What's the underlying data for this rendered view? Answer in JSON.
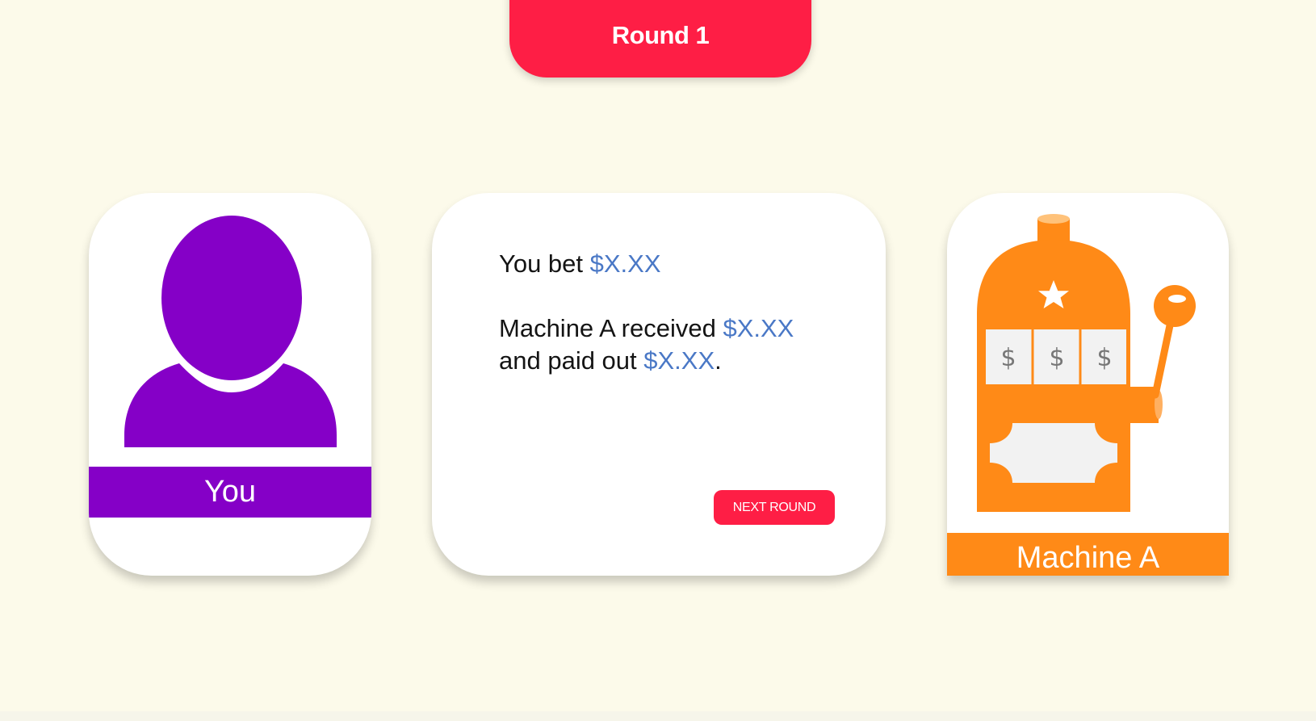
{
  "header": {
    "round_title": "Round 1"
  },
  "player": {
    "label": "You",
    "icon": "person-icon",
    "color": "#8500c7"
  },
  "message": {
    "bet_prefix": "You bet ",
    "bet_amount": "$X.XX",
    "received_prefix": "Machine A received ",
    "received_amount": "$X.XX",
    "paid_prefix": "and paid out ",
    "paid_amount": "$X.XX",
    "paid_suffix": ".",
    "amount_color": "#4a78c6"
  },
  "actions": {
    "next_round_label": "NEXT ROUND",
    "button_color": "#fe1e45"
  },
  "machine": {
    "label": "Machine A",
    "icon": "slot-machine-icon",
    "reel_symbols": [
      "$",
      "$",
      "$"
    ],
    "color": "#ff8a17"
  },
  "colors": {
    "background": "#fcfaea",
    "accent": "#fe1e45"
  }
}
